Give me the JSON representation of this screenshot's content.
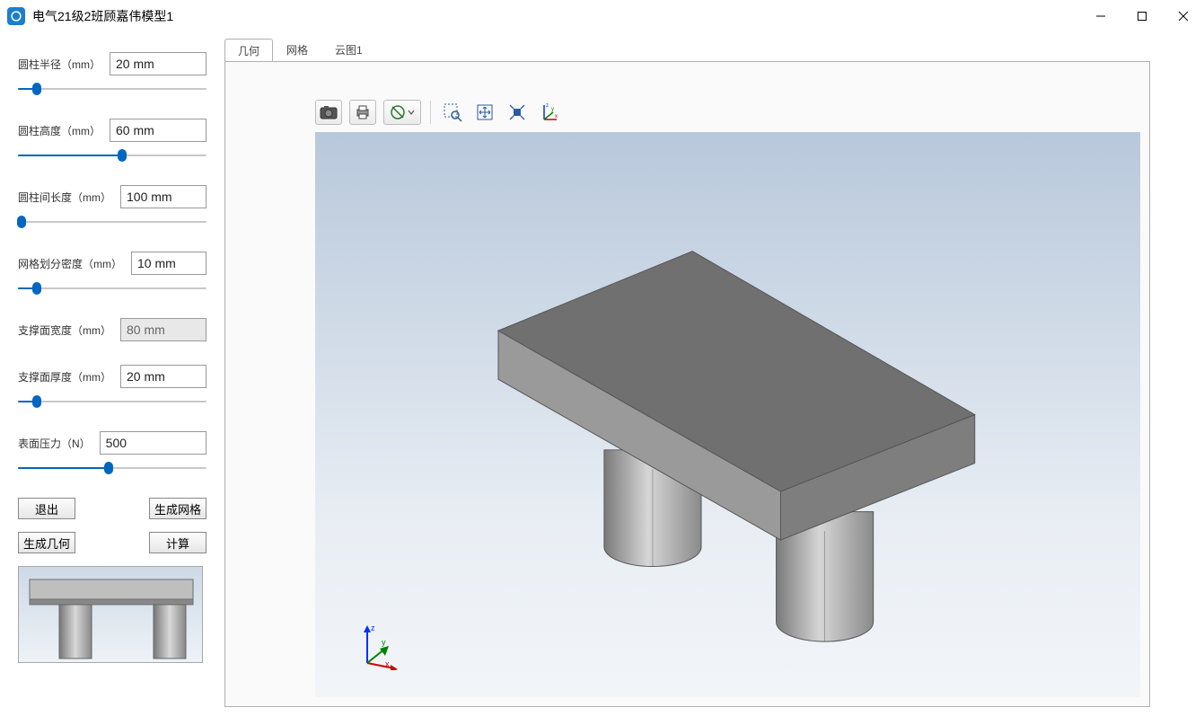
{
  "window": {
    "title": "电气21级2班顾嘉伟模型1"
  },
  "params": {
    "cylinder_radius": {
      "label": "圆柱半径（mm）",
      "value": "20 mm",
      "slider_pct": 10,
      "readonly": false
    },
    "cylinder_height": {
      "label": "圆柱高度（mm）",
      "value": "60 mm",
      "slider_pct": 55,
      "readonly": false
    },
    "cylinder_spacing": {
      "label": "圆柱间长度（mm）",
      "value": "100 mm",
      "slider_pct": 2,
      "readonly": false
    },
    "mesh_density": {
      "label": "网格划分密度（mm）",
      "value": "10 mm",
      "slider_pct": 10,
      "readonly": false
    },
    "support_width": {
      "label": "支撑面宽度（mm）",
      "value": "80 mm",
      "slider_pct": null,
      "readonly": true
    },
    "support_thickness": {
      "label": "支撑面厚度（mm）",
      "value": "20 mm",
      "slider_pct": 10,
      "readonly": false
    },
    "surface_pressure": {
      "label": "表面压力（N）",
      "value": "500",
      "slider_pct": 48,
      "readonly": false
    }
  },
  "buttons": {
    "exit": "退出",
    "gen_mesh": "生成网格",
    "gen_geom": "生成几何",
    "compute": "计算"
  },
  "tabs": {
    "geometry": "几何",
    "mesh": "网格",
    "cloud": "云图1",
    "active": "geometry"
  },
  "axes": {
    "x": "x",
    "y": "y",
    "z": "z"
  },
  "toolbar": {
    "camera": "camera-icon",
    "print": "print-icon",
    "globe": "globe-stop-icon",
    "zoom_window": "zoom-window-icon",
    "pan": "pan-icon",
    "fit": "fit-extents-icon",
    "orient": "axis-orient-icon"
  }
}
